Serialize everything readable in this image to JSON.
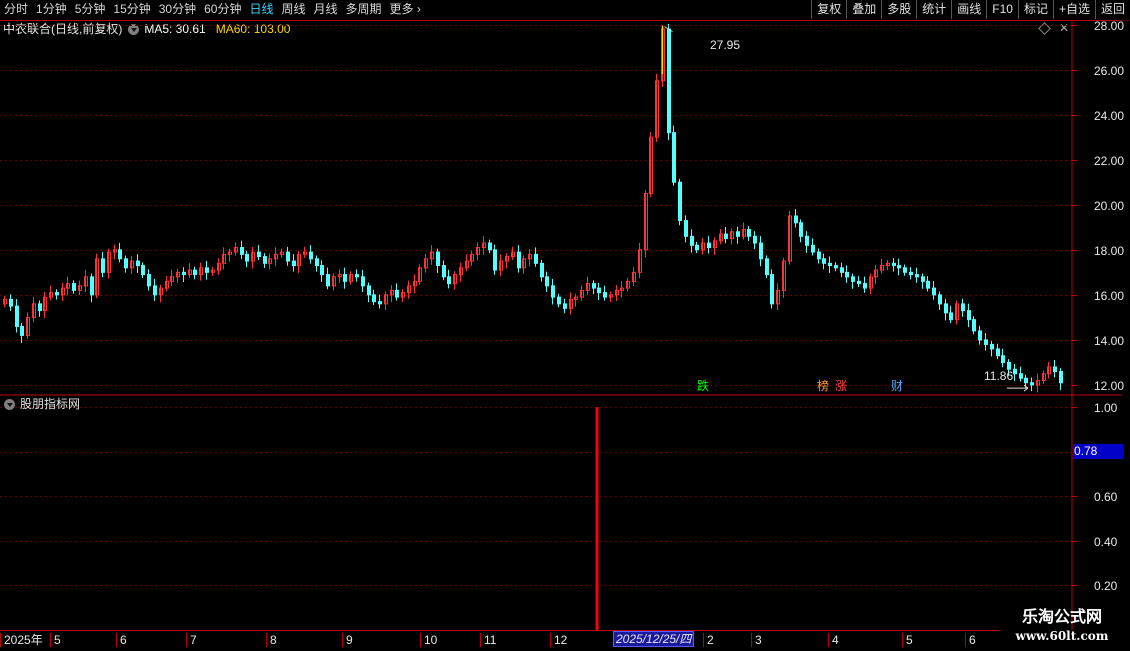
{
  "toolbar": {
    "tabs": [
      "分时",
      "1分钟",
      "5分钟",
      "15分钟",
      "30分钟",
      "60分钟",
      "日线",
      "周线",
      "月线",
      "多周期",
      "更多"
    ],
    "active_tab": "日线",
    "right_buttons": [
      "复权",
      "叠加",
      "多股",
      "统计",
      "画线",
      "F10",
      "标记",
      "+自选",
      "返回"
    ]
  },
  "main_panel": {
    "stock_name": "中农联合(日线,前复权)",
    "ma5": "MA5: 30.61",
    "ma60": "MA60: 103.00",
    "high_label": "27.95",
    "low_label": "11.86",
    "markers": [
      "跌",
      "榜",
      "涨",
      "财"
    ]
  },
  "sub_panel": {
    "title": "股朋指标网",
    "current_value": "0.78",
    "bar_value": 1.0,
    "bar_date": "2025/12/25"
  },
  "colors": {
    "up": "#ff3232",
    "down": "#54ffff",
    "grid": "#6a0000",
    "frame": "#c00000",
    "ma5": "#ffffff",
    "ma60": "#ffd700",
    "indicator_bar": "#ff0000"
  },
  "chart_data": [
    {
      "type": "candlestick",
      "y_axis_ticks": [
        "28.00",
        "26.00",
        "24.00",
        "22.00",
        "20.00",
        "18.00",
        "16.00",
        "14.00",
        "12.00"
      ],
      "ylim": [
        11.6,
        28.2
      ],
      "x_axis_labels": [
        "2025年",
        "5",
        "6",
        "7",
        "8",
        "9",
        "10",
        "11",
        "12",
        "2025/12/25/四",
        "2",
        "3",
        "4",
        "5",
        "6"
      ],
      "close_series": [
        15.8,
        15.5,
        14.6,
        14.2,
        15.0,
        15.6,
        15.3,
        15.9,
        16.1,
        16.0,
        16.3,
        16.5,
        16.2,
        16.4,
        16.8,
        16.0,
        17.6,
        17.0,
        17.9,
        18.0,
        17.6,
        17.2,
        17.5,
        17.3,
        16.9,
        16.4,
        16.0,
        16.3,
        16.6,
        16.8,
        17.0,
        16.9,
        17.1,
        16.9,
        17.2,
        17.0,
        17.1,
        17.4,
        17.8,
        17.9,
        18.1,
        17.8,
        17.5,
        17.9,
        17.7,
        17.4,
        17.6,
        17.8,
        17.9,
        17.5,
        17.3,
        17.8,
        17.9,
        17.6,
        17.3,
        16.9,
        16.4,
        16.8,
        16.9,
        16.6,
        16.9,
        16.8,
        16.4,
        16.0,
        15.7,
        15.6,
        16.0,
        16.2,
        15.9,
        16.1,
        16.4,
        16.6,
        17.2,
        17.6,
        17.9,
        17.3,
        16.8,
        16.5,
        16.9,
        17.2,
        17.5,
        17.8,
        18.1,
        18.3,
        18.0,
        17.1,
        17.5,
        17.7,
        17.9,
        17.2,
        17.6,
        17.8,
        17.4,
        16.8,
        16.4,
        15.9,
        15.6,
        15.4,
        15.8,
        15.9,
        16.2,
        16.5,
        16.3,
        16.1,
        15.9,
        16.0,
        16.2,
        16.3,
        16.6,
        17.0,
        18.0,
        20.5,
        23.0,
        25.5,
        27.8,
        23.2,
        21.0,
        19.3,
        18.6,
        18.2,
        18.0,
        18.3,
        18.1,
        18.4,
        18.7,
        18.5,
        18.8,
        18.6,
        18.9,
        18.6,
        18.3,
        17.6,
        16.9,
        15.6,
        16.2,
        17.5,
        19.5,
        19.2,
        18.6,
        18.2,
        17.9,
        17.6,
        17.4,
        17.3,
        17.2,
        17.0,
        16.8,
        16.6,
        16.5,
        16.3,
        16.8,
        17.1,
        17.3,
        17.4,
        17.3,
        17.2,
        17.0,
        16.9,
        16.8,
        16.6,
        16.3,
        16.0,
        15.6,
        15.2,
        14.9,
        15.6,
        15.3,
        14.9,
        14.4,
        14.0,
        13.8,
        13.6,
        13.3,
        13.0,
        12.7,
        12.5,
        12.3,
        12.1,
        12.0,
        12.2,
        12.5,
        12.8,
        12.6,
        12.1
      ]
    },
    {
      "type": "bar",
      "y_axis_ticks": [
        "1.00",
        "0.60",
        "0.40",
        "0.20"
      ],
      "ylim": [
        0.0,
        1.05
      ],
      "values": [
        1.0
      ]
    }
  ]
}
